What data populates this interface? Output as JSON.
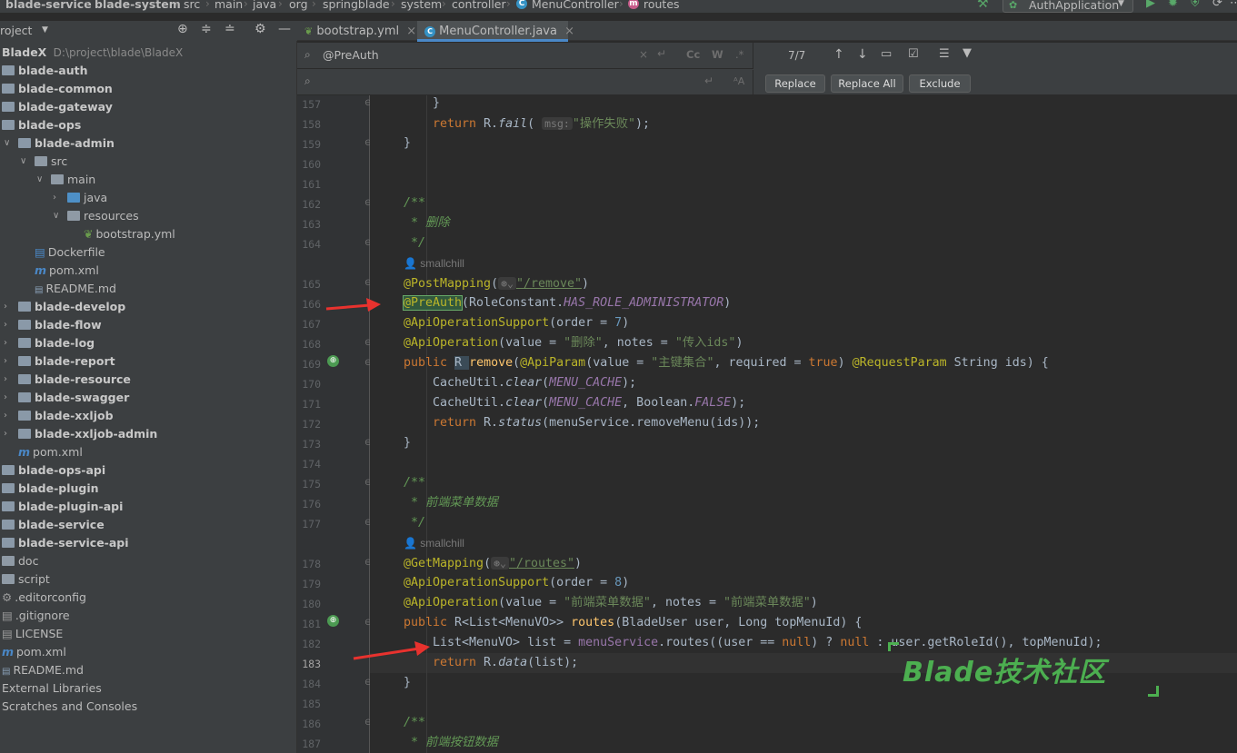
{
  "breadcrumb": [
    "blade-service",
    "blade-system",
    "src",
    "main",
    "java",
    "org",
    "springblade",
    "system",
    "controller",
    "MenuController",
    "routes"
  ],
  "run_config": "AuthApplication",
  "project_label": "roject",
  "tabs": [
    {
      "label": "bootstrap.yml",
      "close": "×"
    },
    {
      "label": "MenuController.java",
      "close": "×"
    }
  ],
  "tree": {
    "root": "BladeX",
    "root_path": "D:\\project\\blade\\BladeX",
    "items": [
      "blade-auth",
      "blade-common",
      "blade-gateway",
      "blade-ops",
      "blade-admin",
      "src",
      "main",
      "java",
      "resources",
      "bootstrap.yml",
      "Dockerfile",
      "pom.xml",
      "README.md",
      "blade-develop",
      "blade-flow",
      "blade-log",
      "blade-report",
      "blade-resource",
      "blade-swagger",
      "blade-xxljob",
      "blade-xxljob-admin",
      "pom.xml",
      "blade-ops-api",
      "blade-plugin",
      "blade-plugin-api",
      "blade-service",
      "blade-service-api",
      "doc",
      "script",
      ".editorconfig",
      ".gitignore",
      "LICENSE",
      "pom.xml",
      "README.md",
      "External Libraries",
      "Scratches and Consoles"
    ]
  },
  "search": {
    "query": "@PreAuth",
    "match_count": "7/7",
    "cc": "Cc",
    "w": "W",
    "regex": ".*",
    "replace_btn": "Replace",
    "replace_all_btn": "Replace All",
    "exclude_btn": "Exclude"
  },
  "editor": {
    "line_numbers": [
      "157",
      "158",
      "159",
      "160",
      "161",
      "162",
      "163",
      "164",
      "165",
      "166",
      "167",
      "168",
      "169",
      "170",
      "171",
      "172",
      "173",
      "174",
      "175",
      "176",
      "177",
      "178",
      "179",
      "180",
      "181",
      "182",
      "183",
      "184",
      "185",
      "186",
      "187"
    ],
    "current_line": "183",
    "author": "smallchill",
    "lines": {
      "l157": "}",
      "l158_return": "return ",
      "l158_r": "R.",
      "l158_fail": "fail",
      "l158_hint": "msg:",
      "l158_str": "\"操作失败\"",
      "l162": "/**",
      "l163": " * 删除",
      "l164": " */",
      "l165_ann": "@PostMapping",
      "l165_path": "\"/remove\"",
      "l166_ann": "@PreAuth",
      "l166_rest": "(RoleConstant.",
      "l166_const": "HAS_ROLE_ADMINISTRATOR",
      "l167_ann": "@ApiOperationSupport",
      "l167_rest": "(order = ",
      "l167_num": "7",
      "l168_ann": "@ApiOperation",
      "l168_a": "(value = ",
      "l168_s1": "\"删除\"",
      "l168_b": ", notes = ",
      "l168_s2": "\"传入ids\"",
      "l169_pub": "public ",
      "l169_r": "R ",
      "l169_fn": "remove",
      "l169_ann": "@ApiParam",
      "l169_a": "(value = ",
      "l169_s": "\"主键集合\"",
      "l169_b": ", required = ",
      "l169_true": "true",
      "l169_ann2": "@RequestParam",
      "l169_c": " String ids) {",
      "l170_a": "CacheUtil.",
      "l170_m": "clear",
      "l170_c": "MENU_CACHE",
      "l171_a": "CacheUtil.",
      "l171_m": "clear",
      "l171_c": "MENU_CACHE",
      "l171_b": ", Boolean.",
      "l171_f": "FALSE",
      "l172_ret": "return ",
      "l172_a": "R.",
      "l172_m": "status",
      "l172_b": "(menuService.removeMenu(ids));",
      "l173": "}",
      "l175": "/**",
      "l176": " * 前端菜单数据",
      "l177": " */",
      "l178_ann": "@GetMapping",
      "l178_path": "\"/routes\"",
      "l179_ann": "@ApiOperationSupport",
      "l179_rest": "(order = ",
      "l179_num": "8",
      "l180_ann": "@ApiOperation",
      "l180_a": "(value = ",
      "l180_s1": "\"前端菜单数据\"",
      "l180_b": ", notes = ",
      "l180_s2": "\"前端菜单数据\"",
      "l181_pub": "public ",
      "l181_a": "R<List<MenuVO>> ",
      "l181_fn": "routes",
      "l181_b": "(BladeUser user, Long topMenuId) {",
      "l182_a": "List<MenuVO> list = ",
      "l182_svc": "menuService",
      "l182_b": ".routes((user == ",
      "l182_null1": "null",
      "l182_c": ") ? ",
      "l182_null2": "null",
      "l182_d": " : user.getRoleId(), topMenuId);",
      "l183_ret": "return ",
      "l183_a": "R.",
      "l183_m": "data",
      "l183_b": "(list);",
      "l184": "}",
      "l186": "/**",
      "l187": " * 前端按钮数据"
    }
  },
  "watermark": "Blade技术社区",
  "colors": {
    "accent_blue": "#4a88c7",
    "arrow_red": "#e8322e",
    "watermark_green": "#4caf50"
  }
}
